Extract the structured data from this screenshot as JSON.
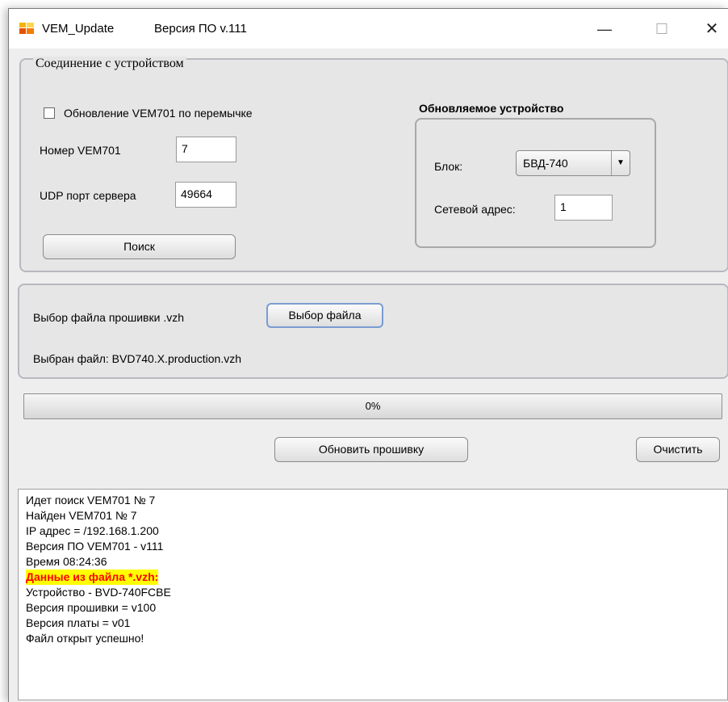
{
  "titlebar": {
    "app_title": "VEM_Update",
    "version": "Версия ПО v.111",
    "minimize": "—",
    "maximize": "☐",
    "close": "✕"
  },
  "connection": {
    "title": "Соединение с устройством",
    "jumper_update_label": "Обновление VEM701 по перемычке",
    "jumper_update_checked": false,
    "vem_number_label": "Номер VEM701",
    "vem_number_value": "7",
    "udp_port_label": "UDP порт сервера",
    "udp_port_value": "49664",
    "search_button": "Поиск"
  },
  "device": {
    "title": "Обновляемое устройство",
    "block_label": "Блок:",
    "block_value": "БВД-740",
    "network_address_label": "Сетевой адрес:",
    "network_address_value": "1"
  },
  "firmware": {
    "select_label": "Выбор файла прошивки .vzh",
    "select_button": "Выбор файла",
    "selected_file": "Выбран файл: BVD740.X.production.vzh"
  },
  "progress": {
    "value": 0,
    "text": "0%"
  },
  "actions": {
    "update_button": "Обновить прошивку",
    "clear_button": "Очистить"
  },
  "log": {
    "lines": [
      "Идет поиск VEM701 № 7",
      "Найден VEM701 № 7",
      "IP адрес = /192.168.1.200",
      "Версия ПО VEM701 - v111",
      "Время 08:24:36",
      "Данные из файла *.vzh:",
      "Устройство - BVD-740FCBE",
      "Версия прошивки = v100",
      "Версия платы = v01",
      "Файл открыт успешно!"
    ],
    "highlight_color": "#ffff00",
    "highlight_text_color": "#ff0000"
  }
}
